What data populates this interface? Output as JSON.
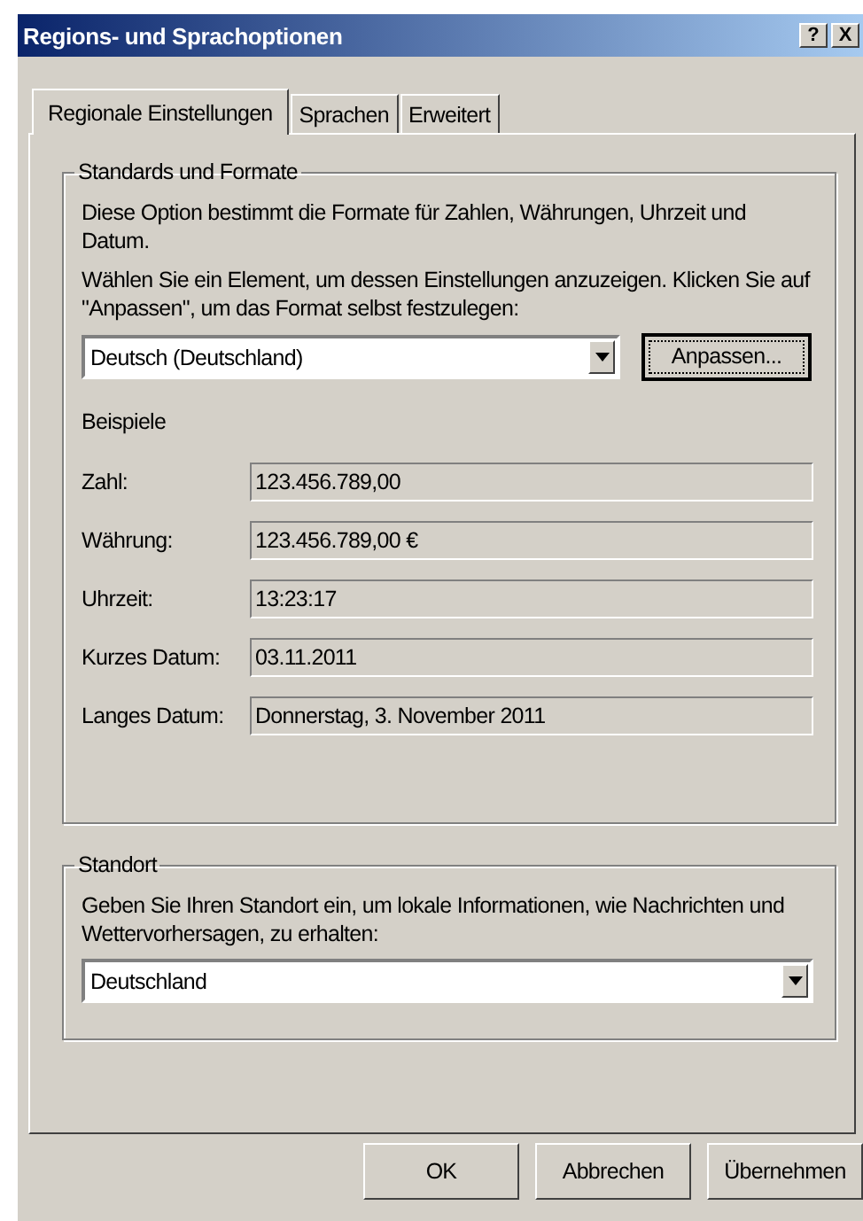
{
  "window": {
    "title": "Regions- und Sprachoptionen",
    "help_button": "?",
    "close_button": "X"
  },
  "tabs": [
    {
      "label": "Regionale Einstellungen",
      "selected": true
    },
    {
      "label": "Sprachen",
      "selected": false
    },
    {
      "label": "Erweitert",
      "selected": false
    }
  ],
  "standards_group": {
    "title": "Standards und Formate",
    "description": "Diese Option bestimmt die Formate für Zahlen, Währungen, Uhrzeit und Datum.",
    "instruction": "Wählen Sie ein Element, um dessen Einstellungen anzuzeigen. Klicken Sie auf \"Anpassen\", um das Format selbst festzulegen:",
    "format_dropdown": {
      "value": "Deutsch (Deutschland)"
    },
    "customize_button": "Anpassen...",
    "examples_heading": "Beispiele",
    "examples": [
      {
        "label": "Zahl:",
        "value": "123.456.789,00"
      },
      {
        "label": "Währung:",
        "value": "123.456.789,00 €"
      },
      {
        "label": "Uhrzeit:",
        "value": "13:23:17"
      },
      {
        "label": "Kurzes Datum:",
        "value": "03.11.2011"
      },
      {
        "label": "Langes Datum:",
        "value": "Donnerstag, 3. November 2011"
      }
    ]
  },
  "location_group": {
    "title": "Standort",
    "instruction": "Geben Sie Ihren Standort ein, um lokale Informationen, wie Nachrichten und Wettervorhersagen, zu erhalten:",
    "location_dropdown": {
      "value": "Deutschland"
    }
  },
  "buttons": [
    "OK",
    "Abbrechen",
    "Übernehmen"
  ]
}
